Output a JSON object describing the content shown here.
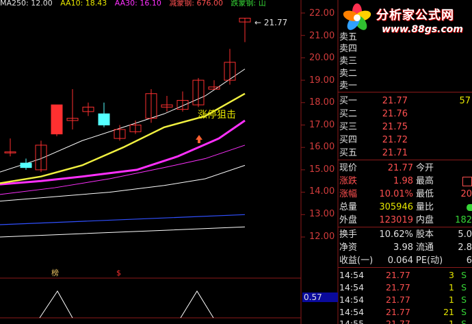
{
  "header": {
    "items": [
      {
        "text": "MA250: 12.00",
        "color": "#e0e0e0"
      },
      {
        "text": "AA10: 18.43",
        "color": "#e8e800"
      },
      {
        "text": "AA30: 16.10",
        "color": "#ff30ff"
      },
      {
        "text": "减蒙钢: 676.00",
        "color": "#ff5050"
      },
      {
        "text": "跌蒙钢: 山",
        "color": "#36d636"
      }
    ]
  },
  "axis": {
    "y_ticks": [
      "22.00",
      "21.00",
      "20.00",
      "19.00",
      "18.00",
      "17.00",
      "16.00",
      "15.00",
      "14.00",
      "13.00",
      "12.00"
    ]
  },
  "chart": {
    "last_price_label": "21.77",
    "signal_text": "涨停狙击",
    "marker_a": "榜",
    "marker_b": "$",
    "indicator_value": "0.57",
    "colors": {
      "grid": "#8b1a1a",
      "up": "#ff3030",
      "down": "#54ffff",
      "ma_white": "#ffffff",
      "ma_yellow": "#f0f040",
      "ma_magenta": "#ff30ff",
      "ma_blue": "#3050ff"
    }
  },
  "logo": {
    "title": "分析家公式网",
    "url": "www.88gs.com"
  },
  "quote": {
    "sell": [
      {
        "label": "卖五",
        "price": ""
      },
      {
        "label": "卖四",
        "price": ""
      },
      {
        "label": "卖三",
        "price": ""
      },
      {
        "label": "卖二",
        "price": ""
      },
      {
        "label": "卖一",
        "price": ""
      }
    ],
    "buy": [
      {
        "label": "买一",
        "price": "21.77",
        "vol": "57"
      },
      {
        "label": "买二",
        "price": "21.76",
        "vol": ""
      },
      {
        "label": "买三",
        "price": "21.75",
        "vol": ""
      },
      {
        "label": "买四",
        "price": "21.72",
        "vol": ""
      },
      {
        "label": "买五",
        "price": "21.71",
        "vol": ""
      }
    ],
    "stats1": [
      {
        "l1": "现价",
        "v1": "21.77",
        "c1": "red",
        "l2": "今开",
        "v2": "",
        "c2": "red"
      },
      {
        "l1": "涨跌",
        "v1": "1.98",
        "c1": "red",
        "l2": "最高",
        "v2": "",
        "c2": "red",
        "box": true
      },
      {
        "l1": "涨幅",
        "v1": "10.01%",
        "c1": "red",
        "l2": "最低",
        "v2": "20",
        "c2": "red"
      },
      {
        "l1": "总量",
        "v1": "305946",
        "c1": "yel",
        "l2": "量比",
        "v2": "",
        "c2": "wht"
      },
      {
        "l1": "外盘",
        "v1": "123019",
        "c1": "red",
        "l2": "内盘",
        "v2": "182",
        "c2": "grn"
      }
    ],
    "stats2": [
      {
        "l1": "换手",
        "v1": "10.62%",
        "l2": "股本",
        "v2": "5.0"
      },
      {
        "l1": "净资",
        "v1": "3.98",
        "l2": "流通",
        "v2": "2.8"
      },
      {
        "l1": "收益(一)",
        "v1": "0.064",
        "l2": "PE(动)",
        "v2": "6"
      }
    ],
    "ticks": [
      {
        "time": "14:54",
        "price": "21.77",
        "vol": "3",
        "side": "S"
      },
      {
        "time": "14:54",
        "price": "21.77",
        "vol": "1",
        "side": "S"
      },
      {
        "time": "14:54",
        "price": "21.77",
        "vol": "1",
        "side": "S"
      },
      {
        "time": "14:54",
        "price": "21.77",
        "vol": "21",
        "side": "S"
      },
      {
        "time": "14:55",
        "price": "21.77",
        "vol": "1",
        "side": "S"
      }
    ]
  }
}
